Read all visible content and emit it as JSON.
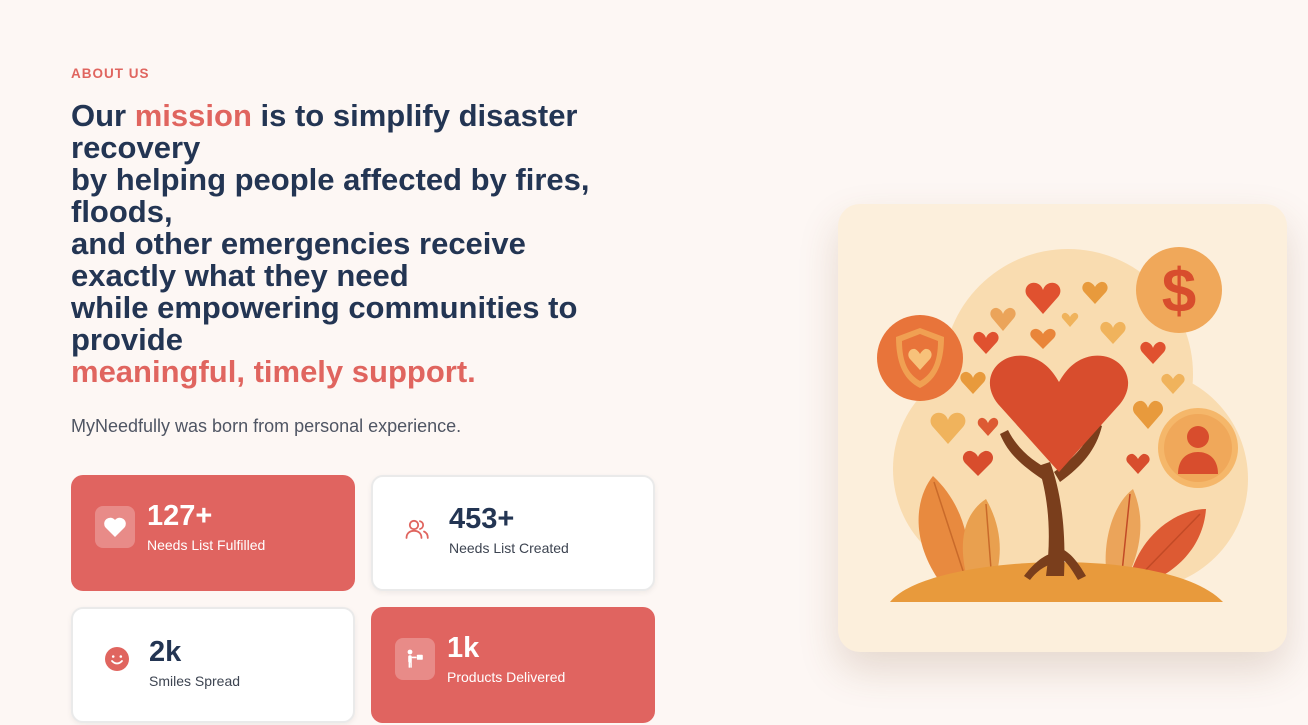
{
  "about": {
    "eyebrow": "ABOUT US",
    "headline": {
      "l1_a": "Our ",
      "l1_b": "mission",
      "l1_c": " is to simplify disaster",
      "l2": "recovery",
      "l3": "by helping people affected by fires,",
      "l4": "floods,",
      "l5": "and other emergencies receive",
      "l6": "exactly what they need",
      "l7": "while empowering communities to",
      "l8": "provide",
      "l9": "meaningful, timely support."
    },
    "intro": "MyNeedfully was born from personal experience."
  },
  "stats": [
    {
      "value": "127+",
      "label": "Needs List Fulfilled",
      "icon": "heart-icon",
      "style": "red"
    },
    {
      "value": "453+",
      "label": "Needs List Created",
      "icon": "users-icon",
      "style": "white"
    },
    {
      "value": "2k",
      "label": "Smiles Spread",
      "icon": "smile-icon",
      "style": "white"
    },
    {
      "value": "1k",
      "label": "Products Delivered",
      "icon": "person-delivery-icon",
      "style": "red"
    }
  ],
  "illustration": {
    "icons": [
      "heart-tree-icon",
      "shield-heart-icon",
      "dollar-coin-icon",
      "person-icon"
    ]
  },
  "colors": {
    "accent": "#e0655f",
    "heading": "#233553",
    "background": "#fdf7f4",
    "card_cream": "#fcefdc"
  }
}
